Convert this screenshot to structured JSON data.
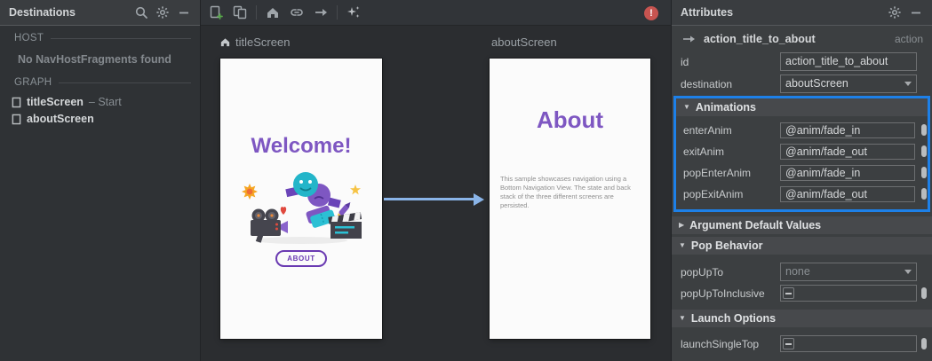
{
  "colors": {
    "highlight_blue": "#1d80e8",
    "arrow_blue": "#8ab4e8",
    "accent_purple": "#7e57c2",
    "button_purple": "#6a3ab2",
    "error_red": "#c75450",
    "panel_bg": "#3c3f41",
    "canvas_bg": "#2b2d30"
  },
  "icons": {
    "left_header": [
      "search-icon",
      "gear-icon",
      "minimize-icon"
    ],
    "toolbar": [
      "new-destination-icon",
      "nested-graph-icon",
      "assign-start-icon",
      "deep-link-icon",
      "action-arrow-icon",
      "auto-arrange-icon"
    ],
    "right_header": [
      "gear-icon",
      "minimize-icon"
    ]
  },
  "destinations_panel": {
    "title": "Destinations",
    "host_section_label": "HOST",
    "host_empty_text": "No NavHostFragments found",
    "graph_section_label": "GRAPH",
    "graph_items": [
      {
        "name": "titleScreen",
        "suffix": "– Start"
      },
      {
        "name": "aboutScreen",
        "suffix": ""
      }
    ]
  },
  "toolbar": {
    "error_badge": "!"
  },
  "canvas": {
    "title_screen": {
      "label": "titleScreen",
      "heading": "Welcome!",
      "button_label": "ABOUT"
    },
    "about_screen": {
      "label": "aboutScreen",
      "heading": "About",
      "body": "This sample showcases navigation using a Bottom Navigation View. The state and back stack of the three different screens are persisted."
    }
  },
  "attributes_panel": {
    "title": "Attributes",
    "selection_name": "action_title_to_about",
    "selection_type": "action",
    "id_label": "id",
    "id_value": "action_title_to_about",
    "destination_label": "destination",
    "destination_value": "aboutScreen",
    "animations": {
      "title": "Animations",
      "rows": [
        {
          "label": "enterAnim",
          "value": "@anim/fade_in"
        },
        {
          "label": "exitAnim",
          "value": "@anim/fade_out"
        },
        {
          "label": "popEnterAnim",
          "value": "@anim/fade_in"
        },
        {
          "label": "popExitAnim",
          "value": "@anim/fade_out"
        }
      ]
    },
    "argument_defaults_title": "Argument Default Values",
    "pop_behavior": {
      "title": "Pop Behavior",
      "pop_up_to_label": "popUpTo",
      "pop_up_to_value": "none",
      "pop_up_to_inclusive_label": "popUpToInclusive"
    },
    "launch_options": {
      "title": "Launch Options",
      "launch_single_top_label": "launchSingleTop"
    }
  }
}
